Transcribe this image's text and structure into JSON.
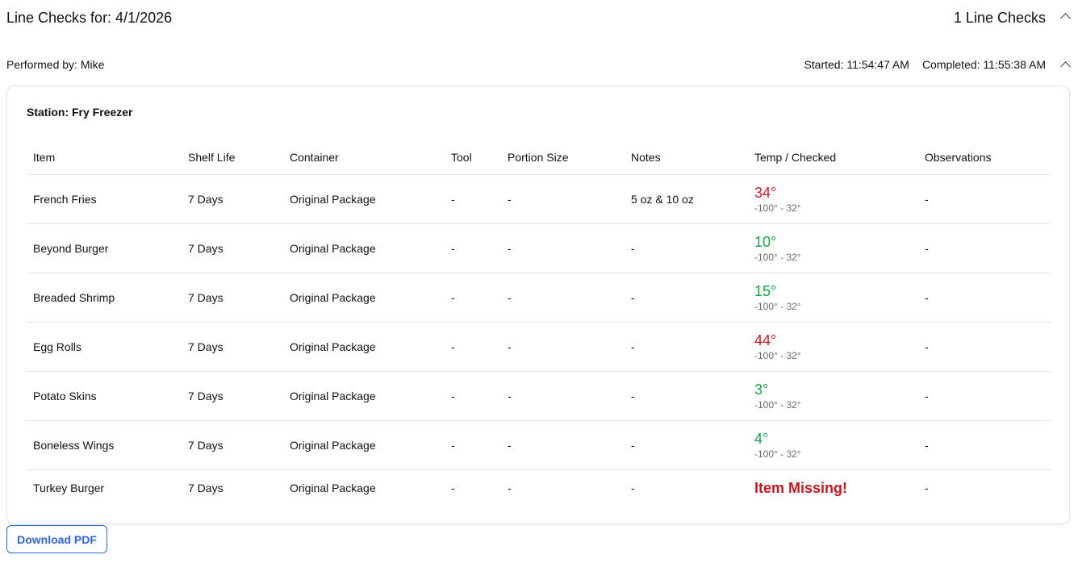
{
  "header": {
    "title": "Line Checks for: 4/1/2026",
    "count": "1 Line Checks"
  },
  "check": {
    "performed_by": "Performed by: Mike",
    "started": "Started: 11:54:47 AM",
    "completed": "Completed: 11:55:38 AM"
  },
  "station": {
    "label": "Station: Fry Freezer"
  },
  "table": {
    "headers": [
      "Item",
      "Shelf Life",
      "Container",
      "Tool",
      "Portion Size",
      "Notes",
      "Temp / Checked",
      "Observations"
    ],
    "rows": [
      {
        "item": "French Fries",
        "shelf_life": "7 Days",
        "container": "Original Package",
        "tool": "-",
        "portion": "-",
        "notes": "5 oz & 10 oz",
        "temp": "34°",
        "status": "out-of-range",
        "range": "-100° - 32°",
        "observations": "-"
      },
      {
        "item": "Beyond Burger",
        "shelf_life": "7 Days",
        "container": "Original Package",
        "tool": "-",
        "portion": "-",
        "notes": "-",
        "temp": "10°",
        "status": "in-range",
        "range": "-100° - 32°",
        "observations": "-"
      },
      {
        "item": "Breaded Shrimp",
        "shelf_life": "7 Days",
        "container": "Original Package",
        "tool": "-",
        "portion": "-",
        "notes": "-",
        "temp": "15°",
        "status": "in-range",
        "range": "-100° - 32°",
        "observations": "-"
      },
      {
        "item": "Egg Rolls",
        "shelf_life": "7 Days",
        "container": "Original Package",
        "tool": "-",
        "portion": "-",
        "notes": "-",
        "temp": "44°",
        "status": "out-of-range",
        "range": "-100° - 32°",
        "observations": "-"
      },
      {
        "item": "Potato Skins",
        "shelf_life": "7 Days",
        "container": "Original Package",
        "tool": "-",
        "portion": "-",
        "notes": "-",
        "temp": "3°",
        "status": "in-range",
        "range": "-100° - 32°",
        "observations": "-"
      },
      {
        "item": "Boneless Wings",
        "shelf_life": "7 Days",
        "container": "Original Package",
        "tool": "-",
        "portion": "-",
        "notes": "-",
        "temp": "4°",
        "status": "in-range",
        "range": "-100° - 32°",
        "observations": "-"
      },
      {
        "item": "Turkey Burger",
        "shelf_life": "7 Days",
        "container": "Original Package",
        "tool": "-",
        "portion": "-",
        "notes": "-",
        "temp": "Item Missing!",
        "status": "missing",
        "range": "",
        "observations": "-"
      }
    ]
  },
  "actions": {
    "download_label": "Download PDF"
  },
  "colors": {
    "out_of_range": "#d11a2a",
    "in_range": "#16a34a",
    "missing": "#c5161d",
    "accent": "#2f63d8"
  },
  "icons": {
    "collapse": "chevron-up-icon"
  }
}
